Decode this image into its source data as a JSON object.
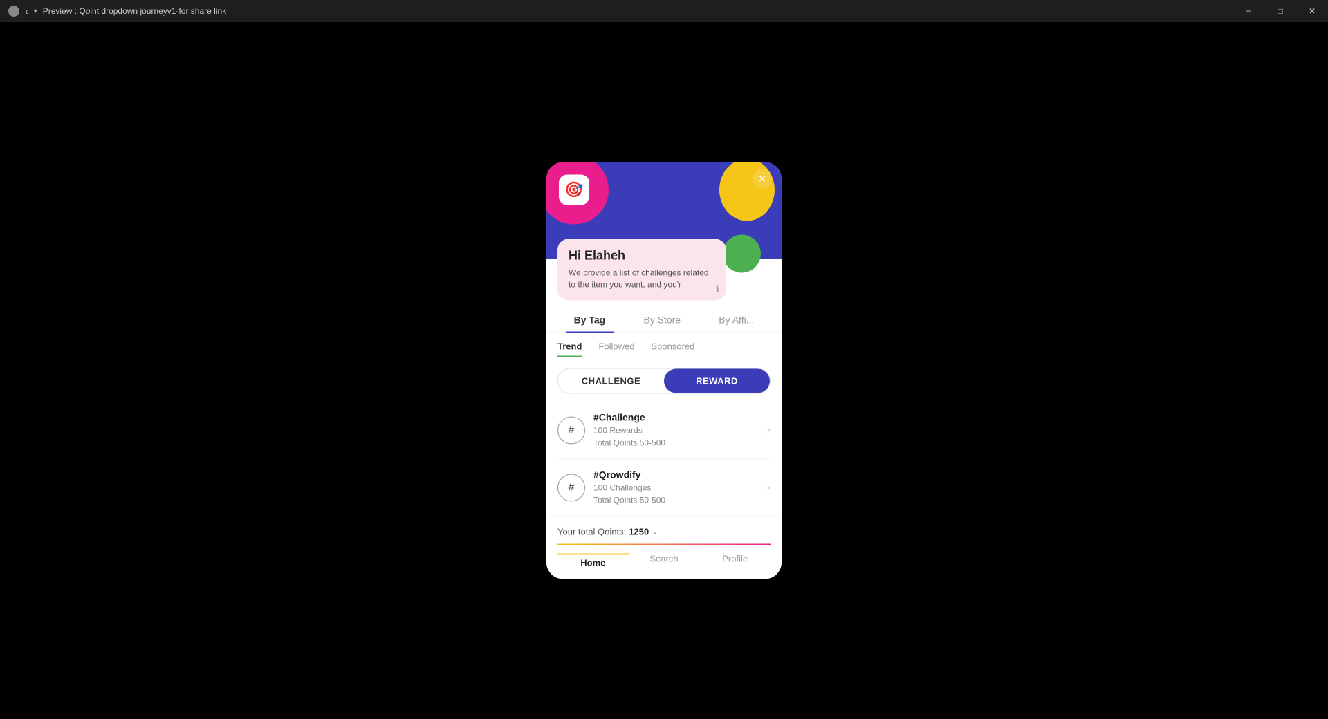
{
  "titleBar": {
    "icon": "⊙",
    "title": "Preview : Qoint dropdown journeyv1-for share link",
    "minimizeLabel": "−",
    "maximizeLabel": "□",
    "closeLabel": "✕"
  },
  "modal": {
    "header": {
      "logoEmoji": "🎯",
      "closeLabel": "✕"
    },
    "welcomeBanner": {
      "greeting": "Hi Elaheh",
      "description": "We provide a list of challenges related to the item you want, and you'r"
    },
    "tabs": [
      {
        "label": "By Tag",
        "active": true
      },
      {
        "label": "By Store",
        "active": false
      },
      {
        "label": "By Affi...",
        "active": false
      }
    ],
    "subTabs": [
      {
        "label": "Trend",
        "active": true
      },
      {
        "label": "Followed",
        "active": false
      },
      {
        "label": "Sponsored",
        "active": false
      }
    ],
    "toggleButtons": [
      {
        "label": "CHALLENGE",
        "active": false
      },
      {
        "label": "REWARD",
        "active": true
      }
    ],
    "listItems": [
      {
        "icon": "#",
        "title": "#Challenge",
        "line1": "100 Rewards",
        "line2": "Total Qoints 50-500"
      },
      {
        "icon": "#",
        "title": "#Qrowdify",
        "line1": "100 Challenges",
        "line2": "Total Qoints 50-500"
      }
    ],
    "totalQoints": {
      "label": "Your total Qoints:",
      "value": "1250",
      "dropdownSymbol": "⌄"
    },
    "bottomNav": [
      {
        "label": "Home",
        "active": true
      },
      {
        "label": "Search",
        "active": false
      },
      {
        "label": "Profile",
        "active": false
      }
    ]
  }
}
